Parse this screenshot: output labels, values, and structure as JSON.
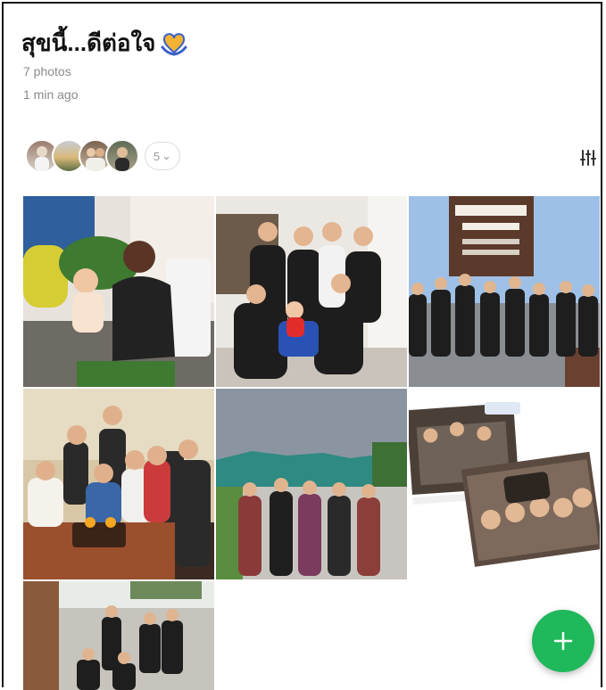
{
  "album": {
    "title": "สุขนี้...ดีต่อใจ",
    "title_emoji": "heart-hands-emoji",
    "photo_count": "7 photos",
    "updated": "1 min ago"
  },
  "members": {
    "avatars": [
      "member-avatar-1",
      "member-avatar-2",
      "member-avatar-3",
      "member-avatar-4"
    ],
    "more_count": "5",
    "more_chevron": "⌄"
  },
  "photos": [
    {
      "name": "photo-1",
      "scene": "woman holding baby on chair"
    },
    {
      "name": "photo-2",
      "scene": "group posing with baby in office"
    },
    {
      "name": "photo-3",
      "scene": "group at farm sign"
    },
    {
      "name": "photo-4",
      "scene": "family with birthday cake"
    },
    {
      "name": "photo-5",
      "scene": "group outdoors by huts"
    },
    {
      "name": "photo-6",
      "scene": "collage of dinner photos"
    },
    {
      "name": "photo-7",
      "scene": "group outside building"
    }
  ],
  "fab": {
    "icon": "plus-icon"
  },
  "colors": {
    "accent": "#1fb85a",
    "meta_text": "#8a8a8a"
  }
}
